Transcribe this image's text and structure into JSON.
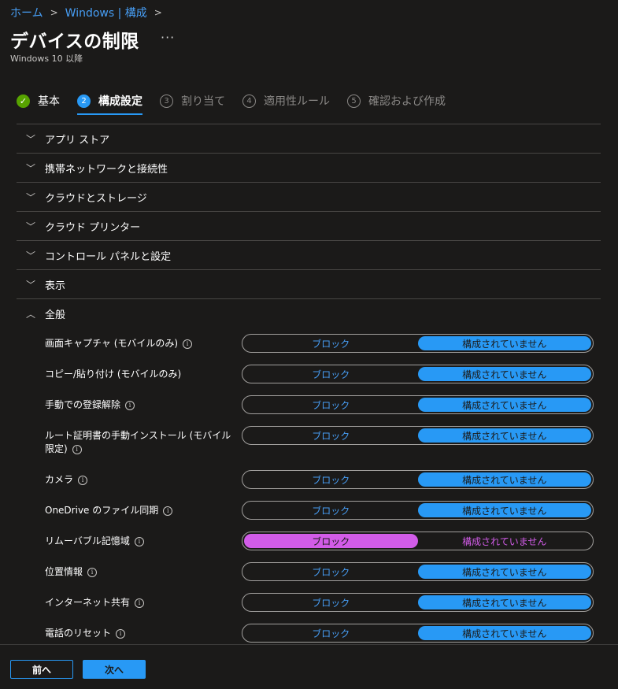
{
  "breadcrumb": {
    "home": "ホーム",
    "current": "Windows | 構成"
  },
  "page": {
    "title": "デバイスの制限",
    "more": "···",
    "subtitle": "Windows 10 以降"
  },
  "steps": [
    {
      "num": "✓",
      "label": "基本",
      "state": "done"
    },
    {
      "num": "2",
      "label": "構成設定",
      "state": "active"
    },
    {
      "num": "3",
      "label": "割り当て",
      "state": "pending"
    },
    {
      "num": "4",
      "label": "適用性ルール",
      "state": "pending"
    },
    {
      "num": "5",
      "label": "確認および作成",
      "state": "pending"
    }
  ],
  "sections": [
    {
      "label": "アプリ ストア",
      "expanded": false,
      "chevron": "﹀"
    },
    {
      "label": "携帯ネットワークと接続性",
      "expanded": false,
      "chevron": "﹀"
    },
    {
      "label": "クラウドとストレージ",
      "expanded": false,
      "chevron": "﹀"
    },
    {
      "label": "クラウド プリンター",
      "expanded": false,
      "chevron": "﹀"
    },
    {
      "label": "コントロール パネルと設定",
      "expanded": false,
      "chevron": "﹀"
    },
    {
      "label": "表示",
      "expanded": false,
      "chevron": "﹀"
    },
    {
      "label": "全般",
      "expanded": true,
      "chevron": "︿"
    }
  ],
  "toggle_labels": {
    "block": "ブロック",
    "not_configured": "構成されていません"
  },
  "info_glyph": "i",
  "settings": [
    {
      "label": "画面キャプチャ (モバイルのみ)",
      "value": "not_configured"
    },
    {
      "label": "コピー/貼り付け (モバイルのみ)",
      "value": "not_configured",
      "no_info": true
    },
    {
      "label": "手動での登録解除",
      "value": "not_configured"
    },
    {
      "label": "ルート証明書の手動インストール (モバイル限定)",
      "value": "not_configured",
      "tall": true
    },
    {
      "label": "カメラ",
      "value": "not_configured"
    },
    {
      "label": "OneDrive のファイル同期",
      "value": "not_configured"
    },
    {
      "label": "リムーバブル記憶域",
      "value": "block"
    },
    {
      "label": "位置情報",
      "value": "not_configured"
    },
    {
      "label": "インターネット共有",
      "value": "not_configured"
    },
    {
      "label": "電話のリセット",
      "value": "not_configured"
    }
  ],
  "footer": {
    "prev": "前へ",
    "next": "次へ"
  },
  "colors": {
    "accent": "#2899f5",
    "block_selected": "#d25ce8",
    "success": "#57a300"
  }
}
